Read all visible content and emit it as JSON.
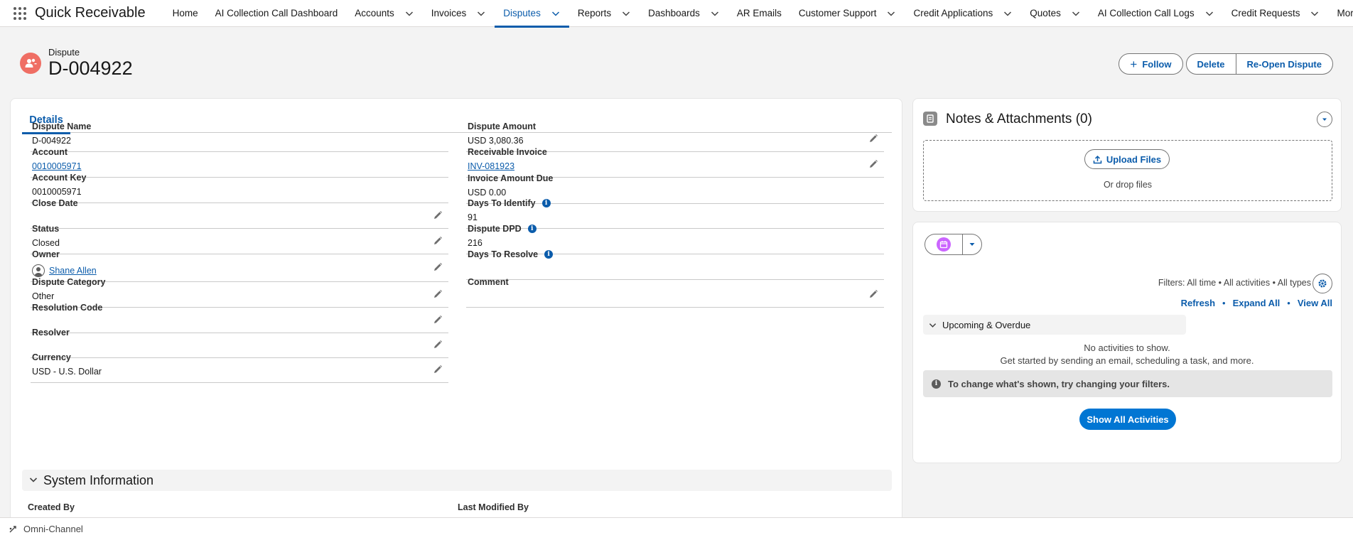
{
  "nav": {
    "app_name": "Quick Receivable",
    "items": [
      {
        "label": "Home",
        "dropdown": false,
        "active": false
      },
      {
        "label": "AI Collection Call Dashboard",
        "dropdown": false,
        "active": false
      },
      {
        "label": "Accounts",
        "dropdown": true,
        "active": false
      },
      {
        "label": "Invoices",
        "dropdown": true,
        "active": false
      },
      {
        "label": "Disputes",
        "dropdown": true,
        "active": true
      },
      {
        "label": "Reports",
        "dropdown": true,
        "active": false
      },
      {
        "label": "Dashboards",
        "dropdown": true,
        "active": false
      },
      {
        "label": "AR Emails",
        "dropdown": false,
        "active": false
      },
      {
        "label": "Customer Support",
        "dropdown": true,
        "active": false
      },
      {
        "label": "Credit Applications",
        "dropdown": true,
        "active": false
      },
      {
        "label": "Quotes",
        "dropdown": true,
        "active": false
      },
      {
        "label": "AI Collection Call Logs",
        "dropdown": true,
        "active": false
      },
      {
        "label": "Credit Requests",
        "dropdown": true,
        "active": false
      }
    ],
    "more_label": "More"
  },
  "header": {
    "object_type": "Dispute",
    "record_name": "D-004922",
    "buttons": {
      "follow": "Follow",
      "delete": "Delete",
      "reopen": "Re-Open Dispute"
    }
  },
  "details": {
    "tab_label": "Details",
    "left_fields": [
      {
        "label": "Dispute Name",
        "value": "D-004922",
        "type": "text",
        "editable": false
      },
      {
        "label": "Account",
        "value": "0010005971",
        "type": "link",
        "editable": false
      },
      {
        "label": "Account Key",
        "value": "0010005971",
        "type": "text",
        "editable": false
      },
      {
        "label": "Close Date",
        "value": "",
        "type": "text",
        "editable": true
      },
      {
        "label": "Status",
        "value": "Closed",
        "type": "text",
        "editable": true
      },
      {
        "label": "Owner",
        "value": "Shane Allen",
        "type": "user",
        "editable": true
      },
      {
        "label": "Dispute Category",
        "value": "Other",
        "type": "text",
        "editable": true
      },
      {
        "label": "Resolution Code",
        "value": "",
        "type": "text",
        "editable": true
      },
      {
        "label": "Resolver",
        "value": "",
        "type": "text",
        "editable": true
      },
      {
        "label": "Currency",
        "value": "USD - U.S. Dollar",
        "type": "text",
        "editable": true
      }
    ],
    "right_fields": [
      {
        "label": "Dispute Amount",
        "value": "USD 3,080.36",
        "type": "text",
        "editable": true,
        "info": false
      },
      {
        "label": "Receivable Invoice",
        "value": "INV-081923",
        "type": "link",
        "editable": true,
        "info": false
      },
      {
        "label": "Invoice Amount Due",
        "value": "USD 0.00",
        "type": "text",
        "editable": false,
        "info": false
      },
      {
        "label": "Days To Identify",
        "value": "91",
        "type": "text",
        "editable": false,
        "info": true
      },
      {
        "label": "Dispute DPD",
        "value": "216",
        "type": "text",
        "editable": false,
        "info": true
      },
      {
        "label": "Days To Resolve",
        "value": "",
        "type": "text",
        "editable": false,
        "info": true
      },
      {
        "label": "Comment",
        "value": "",
        "type": "text",
        "editable": true,
        "info": false
      }
    ],
    "system_section": {
      "title": "System Information",
      "created_by_label": "Created By",
      "modified_by_label": "Last Modified By"
    }
  },
  "notes": {
    "title": "Notes & Attachments (0)",
    "upload_label": "Upload Files",
    "drop_text": "Or drop files"
  },
  "activity": {
    "filters_text": "Filters: All time • All activities • All types",
    "links": {
      "refresh": "Refresh",
      "expand_all": "Expand All",
      "view_all": "View All"
    },
    "upcoming_label": "Upcoming & Overdue",
    "no_activities": "No activities to show.",
    "get_started": "Get started by sending an email, scheduling a task, and more.",
    "filter_tip": "To change what's shown, try changing your filters.",
    "show_all_label": "Show All Activities"
  },
  "footer": {
    "omni_label": "Omni-Channel"
  },
  "colors": {
    "brand_blue": "#0b5cab",
    "button_blue": "#0176d3",
    "dispute_icon": "#ef6e64",
    "calendar_icon": "#cb65ff"
  }
}
